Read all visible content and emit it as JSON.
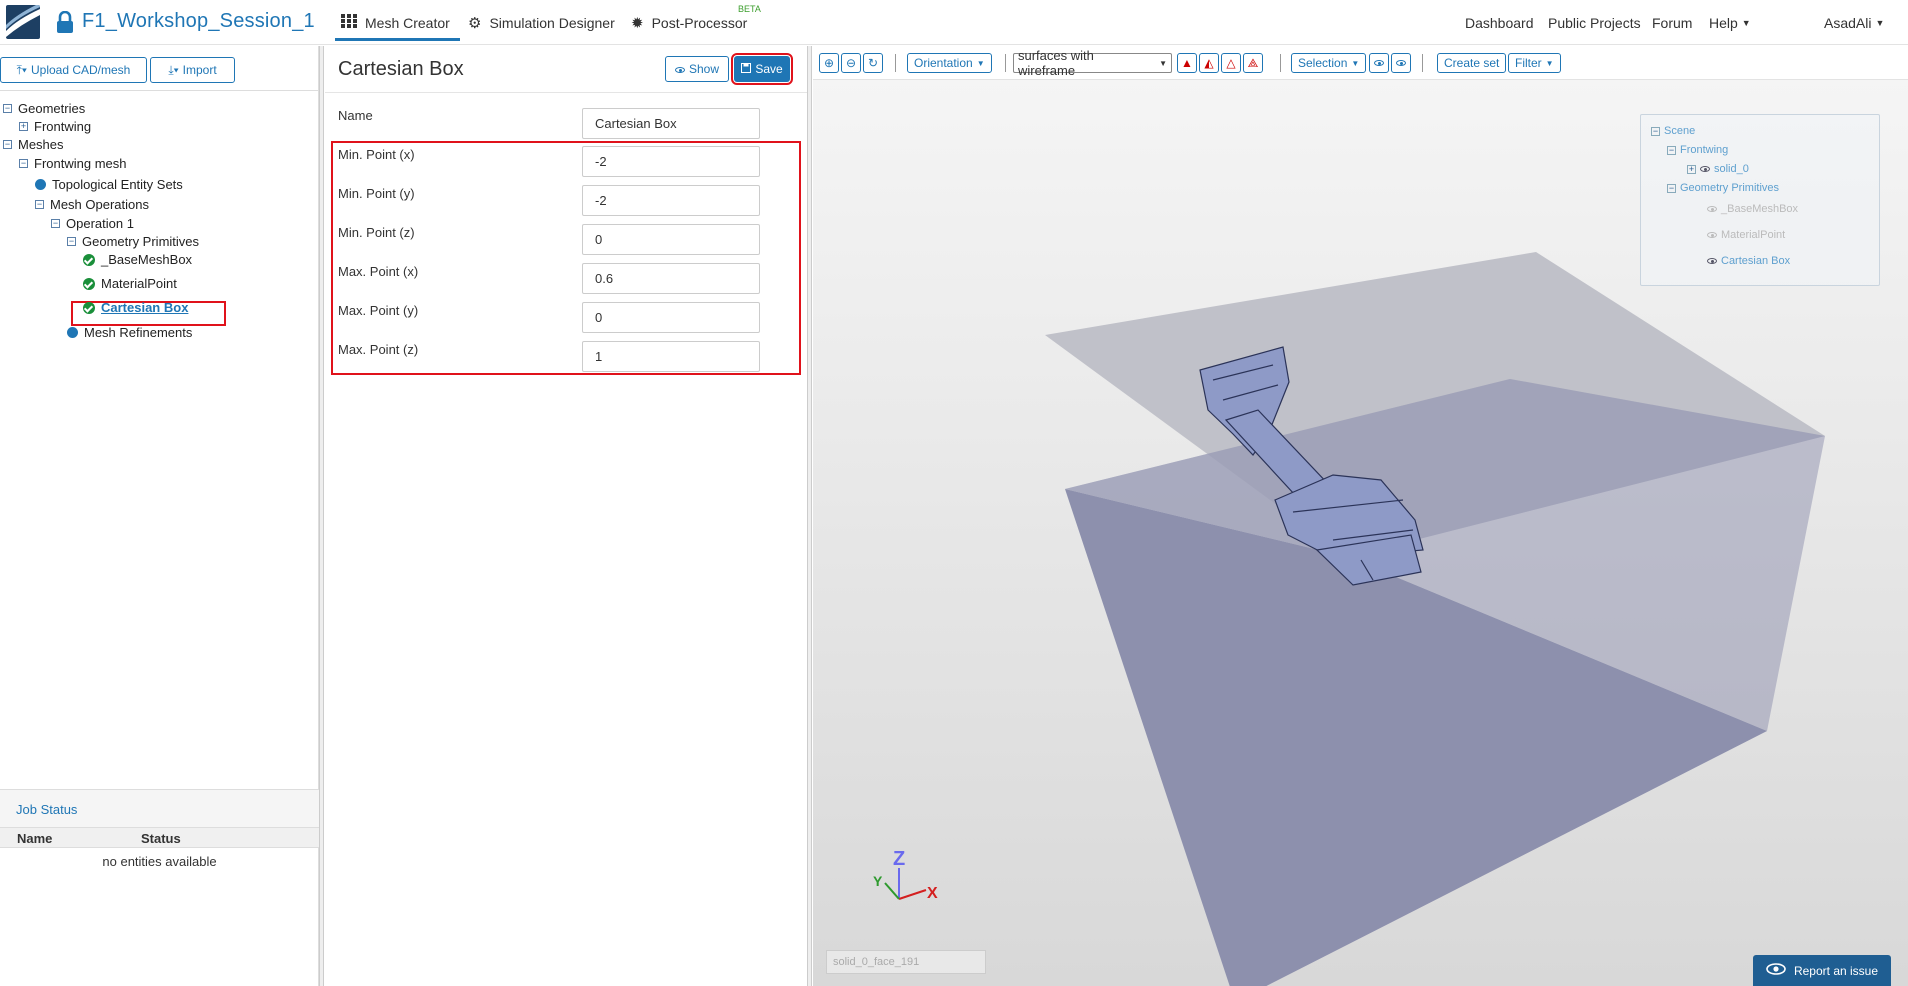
{
  "header": {
    "project_title": "F1_Workshop_Session_1",
    "tabs": [
      {
        "label": "Mesh Creator"
      },
      {
        "label": "Simulation Designer"
      },
      {
        "label": "Post-Processor",
        "badge": "BETA"
      }
    ],
    "right_links": [
      "Dashboard",
      "Public Projects",
      "Forum",
      "Help"
    ],
    "user": "AsadAli"
  },
  "left": {
    "upload_label": "Upload CAD/mesh",
    "import_label": "Import",
    "tree": {
      "geometries": "Geometries",
      "frontwing": "Frontwing",
      "meshes": "Meshes",
      "frontwing_mesh": "Frontwing mesh",
      "topo_sets": "Topological Entity Sets",
      "mesh_ops": "Mesh Operations",
      "operation1": "Operation 1",
      "geo_prims": "Geometry Primitives",
      "base_mesh_box": "_BaseMeshBox",
      "material_point": "MaterialPoint",
      "cartesian_box": "Cartesian Box",
      "mesh_refinements": "Mesh Refinements"
    },
    "job_status": {
      "title": "Job Status",
      "col_name": "Name",
      "col_status": "Status",
      "empty": "no entities available"
    }
  },
  "form": {
    "title": "Cartesian Box",
    "show_label": "Show",
    "save_label": "Save",
    "name_label": "Name",
    "name_value": "Cartesian Box",
    "fields": [
      {
        "label": "Min. Point (x)",
        "value": "-2"
      },
      {
        "label": "Min. Point (y)",
        "value": "-2"
      },
      {
        "label": "Min. Point (z)",
        "value": "0"
      },
      {
        "label": "Max. Point (x)",
        "value": "0.6"
      },
      {
        "label": "Max. Point (y)",
        "value": "0"
      },
      {
        "label": "Max. Point (z)",
        "value": "1"
      }
    ]
  },
  "viewer": {
    "orientation_label": "Orientation",
    "render_mode": "surfaces with wireframe",
    "selection_label": "Selection",
    "create_set_label": "Create set",
    "filter_label": "Filter",
    "scene": {
      "root": "Scene",
      "frontwing": "Frontwing",
      "solid": "solid_0",
      "geo_prims": "Geometry Primitives",
      "base_mesh_box": "_BaseMeshBox",
      "material_point": "MaterialPoint",
      "cartesian_box": "Cartesian Box"
    },
    "status_text": "solid_0_face_191",
    "axes": {
      "x": "X",
      "y": "Y",
      "z": "Z"
    },
    "report_label": "Report an issue"
  },
  "colors": {
    "accent": "#1f76b5",
    "highlight": "#e0121b",
    "ok_green": "#1a8f3a",
    "box_top": "#bcbdc8",
    "box_front": "#8a8dab",
    "wing": "#8b97c4"
  }
}
